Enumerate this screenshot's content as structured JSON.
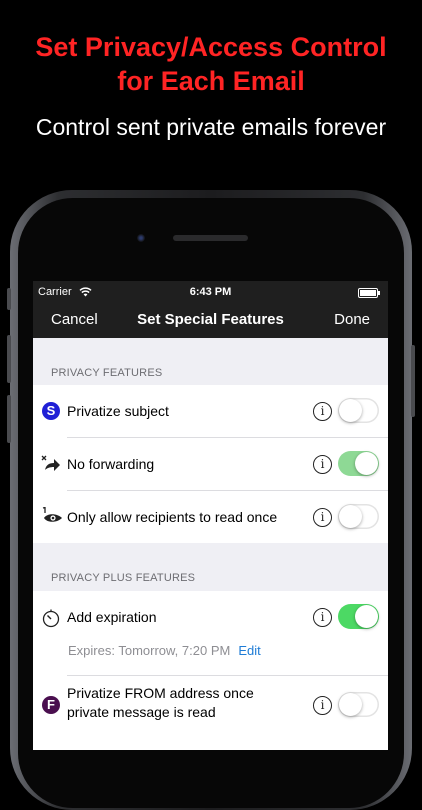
{
  "promo": {
    "headline_line1": "Set Privacy/Access Control",
    "headline_line2": "for Each Email",
    "subheadline": "Control sent private emails forever"
  },
  "status_bar": {
    "carrier": "Carrier",
    "time": "6:43 PM"
  },
  "nav": {
    "cancel": "Cancel",
    "title": "Set Special Features",
    "done": "Done"
  },
  "sections": [
    {
      "header": "PRIVACY FEATURES",
      "rows": [
        {
          "label": "Privatize subject",
          "icon": "S",
          "icon_name": "privatize-subject-icon",
          "icon_color": "#1f1fd6",
          "enabled": false
        },
        {
          "label": "No forwarding",
          "icon_name": "no-forwarding-icon",
          "enabled": true
        },
        {
          "label": "Only allow recipients to read once",
          "icon_name": "read-once-icon",
          "enabled": false
        }
      ]
    },
    {
      "header": "PRIVACY PLUS FEATURES",
      "rows": [
        {
          "label": "Add expiration",
          "icon_name": "timer-icon",
          "enabled": true,
          "detail": "Expires: Tomorrow, 7:20 PM",
          "detail_action": "Edit"
        },
        {
          "label_line1": "Privatize FROM address once",
          "label_line2": "private message is read",
          "icon": "F",
          "icon_name": "privatize-from-icon",
          "icon_color": "#4a0f4f",
          "enabled": false
        }
      ]
    }
  ],
  "colors": {
    "headline": "#ff2424",
    "toggle_on_dim": "#8ed995",
    "toggle_on": "#4cd964",
    "edit_link": "#1e7cd6"
  }
}
